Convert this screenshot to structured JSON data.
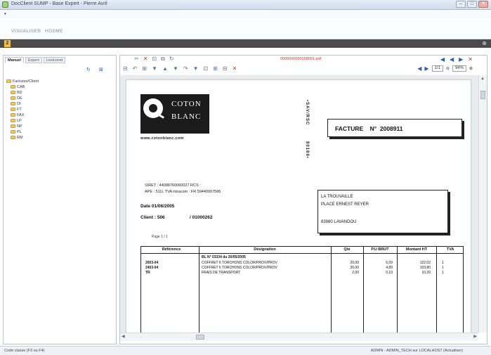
{
  "window": {
    "title": "DocClient SUMP - Base Expert - Pierre Avril",
    "buttons": [
      "–",
      "□",
      "✕"
    ]
  },
  "quickbar": {
    "mark": "•"
  },
  "ribbon": {
    "tabs": [
      "VISUALISER",
      "HOSME"
    ]
  },
  "darkbar": {
    "doc_number": "2",
    "pin": "⊕"
  },
  "leftpane": {
    "tabs": [
      "Manuel",
      "Expert",
      "Lexiconet"
    ],
    "tools": [
      "↻",
      "⊠"
    ],
    "tree": [
      {
        "label": "Factures/Client",
        "child": false
      },
      {
        "label": "CAB",
        "child": true
      },
      {
        "label": "BD",
        "child": true
      },
      {
        "label": "DE",
        "child": true
      },
      {
        "label": "DI",
        "child": true
      },
      {
        "label": "FT",
        "child": true
      },
      {
        "label": "FAX",
        "child": true
      },
      {
        "label": "LP",
        "child": true
      },
      {
        "label": "NP",
        "child": true
      },
      {
        "label": "PL",
        "child": true
      },
      {
        "label": "RM",
        "child": true
      }
    ]
  },
  "toolbar": {
    "icons_top": [
      "✂",
      "✕",
      "⊡",
      "⧉",
      "↻"
    ],
    "filename": "0000000000038001.pdf",
    "nav": [
      "◀",
      "◀",
      "▶",
      "✕"
    ],
    "icons_second": [
      "⊟",
      "↶",
      "⊞",
      "▼",
      "▲",
      "▼",
      "↷",
      "▼",
      "⊡",
      "⊞",
      "⊟",
      "✕"
    ],
    "page_prev": "◀",
    "page_next": "▶",
    "page": "1/1",
    "zoom": "94%",
    "zoom_icon": "⊕"
  },
  "invoice": {
    "logo_line1": "COTON",
    "logo_line2": "BLANC",
    "logo_url": "www.cotonblanc.com",
    "vertical_top": "•SAV/RSC",
    "vertical_bottom": "80189•",
    "facture_label": "FACTURE",
    "facture_no_label": "N°",
    "facture_number": "2008911",
    "siret": "SIRET : 44088760060027  RCS :",
    "ape": "APE : 511L    TVA intracom : FR 59440007586",
    "date": "Date  01/06/2005",
    "client_label": "Client :  506",
    "client_number": "/ 01000262",
    "page": "Page 1 / 1",
    "address": [
      "LA TROUVAILLE",
      "PLACE ERNEST REYER",
      "83980   LAVANDOU"
    ],
    "table": {
      "headers": [
        "Référence",
        "Désignation",
        "Qté",
        "P.U BRUT",
        "Montant HT",
        "TVA"
      ],
      "rows": [
        {
          "ref": "",
          "des": "BL N° 03334 du 20/05/2005",
          "qty": "",
          "pu": "",
          "ht": "",
          "tva": ""
        },
        {
          "ref": "2003-04",
          "des": "COFFRET 6 TORCHONS COLOR/PROV/PROV",
          "qty": "20,00",
          "pu": "6,09",
          "ht": "122,02",
          "tva": "1"
        },
        {
          "ref": "2403-04",
          "des": "COFFRET 6 TORCHONS COLOR/PROV/PROV",
          "qty": "20,00",
          "pu": "4,89",
          "ht": "103,80",
          "tva": "1"
        },
        {
          "ref": "TR",
          "des": "FRAIS DE TRANSPORT",
          "qty": "2,00",
          "pu": "0,10",
          "ht": "10,20",
          "tva": "1"
        }
      ]
    }
  },
  "status": {
    "left": "Code classe (F3 ou F4)",
    "right": "ADMIN - ADMIN_TECH sur LOCALHOST (Actualiser)"
  }
}
